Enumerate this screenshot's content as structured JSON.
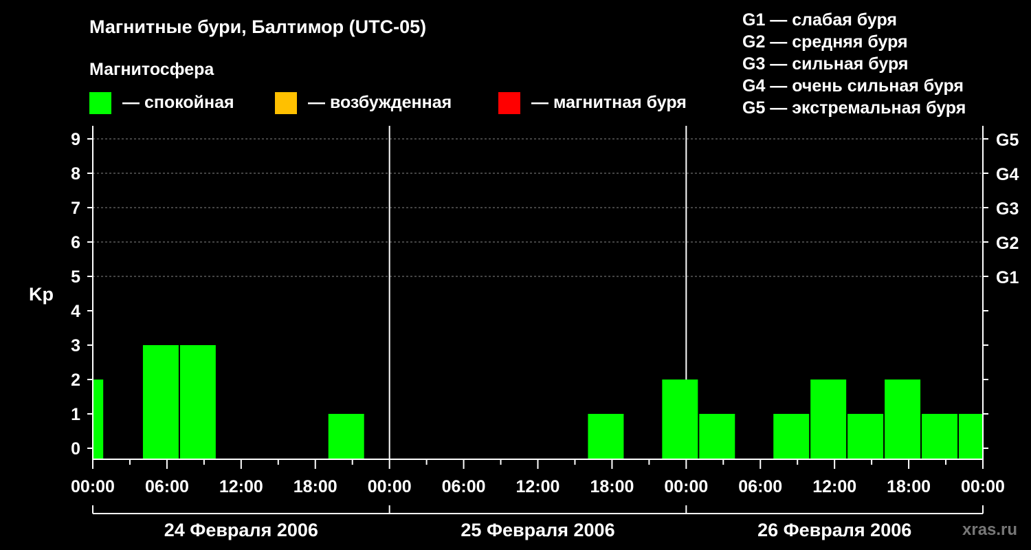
{
  "chart_data": {
    "type": "bar",
    "title": "Магнитные бури, Балтимор (UTC-05)",
    "subtitle": "Магнитосфера",
    "legend": [
      {
        "label": "— спокойная",
        "color": "#00ff00"
      },
      {
        "label": "— возбужденная",
        "color": "#ffc000"
      },
      {
        "label": "— магнитная буря",
        "color": "#ff0000"
      }
    ],
    "g_legend": [
      "G1 — слабая буря",
      "G2 — средняя буря",
      "G3 — сильная буря",
      "G4 — очень сильная буря",
      "G5 — экстремальная буря"
    ],
    "ylabel": "Kp",
    "ylim": [
      0,
      9
    ],
    "yticks": [
      "0",
      "1",
      "2",
      "3",
      "4",
      "5",
      "6",
      "7",
      "8",
      "9"
    ],
    "g_ticks": [
      {
        "kp": 5,
        "label": "G1"
      },
      {
        "kp": 6,
        "label": "G2"
      },
      {
        "kp": 7,
        "label": "G3"
      },
      {
        "kp": 8,
        "label": "G4"
      },
      {
        "kp": 9,
        "label": "G5"
      }
    ],
    "xticks": [
      "00:00",
      "06:00",
      "12:00",
      "18:00",
      "00:00",
      "06:00",
      "12:00",
      "18:00",
      "00:00",
      "06:00",
      "12:00",
      "18:00",
      "00:00"
    ],
    "days": [
      "24 Февраля 2006",
      "25 Февраля 2006",
      "26 Февраля 2006"
    ],
    "grid": true,
    "bars": [
      {
        "start_hour": 0,
        "end_hour": 0.9,
        "kp": 2
      },
      {
        "start_hour": 4,
        "end_hour": 7,
        "kp": 3
      },
      {
        "start_hour": 7,
        "end_hour": 10,
        "kp": 3
      },
      {
        "start_hour": 19,
        "end_hour": 22,
        "kp": 1
      },
      {
        "start_hour": 40,
        "end_hour": 43,
        "kp": 1
      },
      {
        "start_hour": 46,
        "end_hour": 49,
        "kp": 2
      },
      {
        "start_hour": 49,
        "end_hour": 52,
        "kp": 1
      },
      {
        "start_hour": 55,
        "end_hour": 58,
        "kp": 1
      },
      {
        "start_hour": 58,
        "end_hour": 61,
        "kp": 2
      },
      {
        "start_hour": 61,
        "end_hour": 64,
        "kp": 1
      },
      {
        "start_hour": 64,
        "end_hour": 67,
        "kp": 2
      },
      {
        "start_hour": 67,
        "end_hour": 70,
        "kp": 1
      },
      {
        "start_hour": 70,
        "end_hour": 72,
        "kp": 1
      }
    ],
    "bar_color": "#00ff00"
  },
  "watermark": "xras.ru"
}
